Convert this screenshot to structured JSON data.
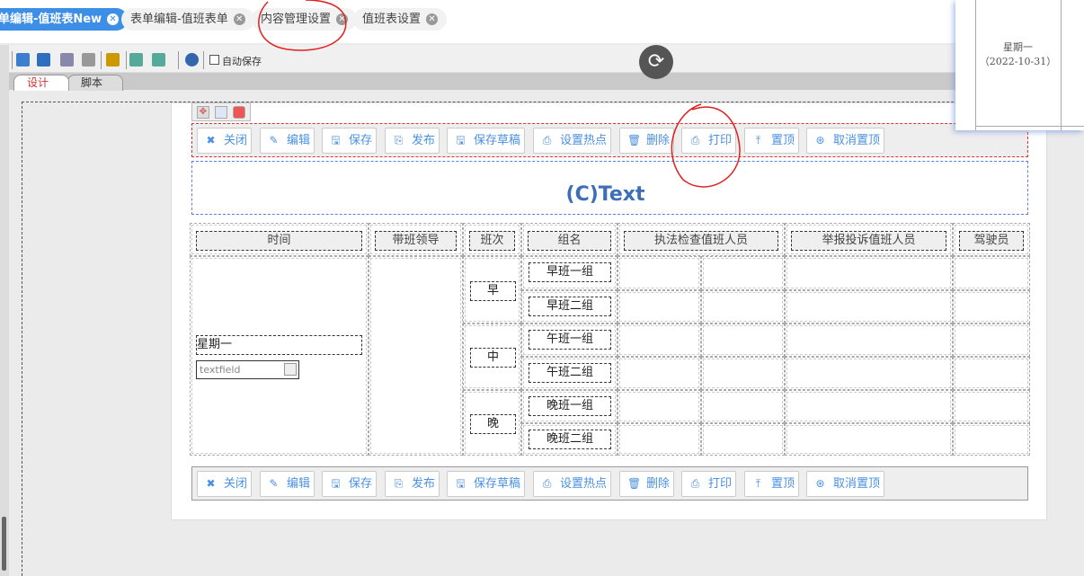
{
  "tabs": [
    {
      "label": "单编辑-值班表New",
      "active": true
    },
    {
      "label": "表单编辑-值班表单"
    },
    {
      "label": "内容管理设置"
    },
    {
      "label": "值班表设置"
    }
  ],
  "toolbar": {
    "autosave_label": "自动保存",
    "icons": [
      "save-icon",
      "save-as-icon",
      "preview-icon",
      "print-icon",
      "wand-icon",
      "import-icon",
      "export-icon",
      "help-icon"
    ]
  },
  "designer_tabs": [
    "设计",
    "脚本"
  ],
  "buttons": [
    {
      "label": "关闭",
      "icon": "✖"
    },
    {
      "label": "编辑",
      "icon": "✎"
    },
    {
      "label": "保存",
      "icon": "🖫"
    },
    {
      "label": "发布",
      "icon": "⎘"
    },
    {
      "label": "保存草稿",
      "icon": "🖫"
    },
    {
      "label": "设置热点",
      "icon": "⎙"
    },
    {
      "label": "删除",
      "icon": "🗑"
    },
    {
      "label": "打印",
      "icon": "⎙"
    },
    {
      "label": "置顶",
      "icon": "⤒"
    },
    {
      "label": "取消置顶",
      "icon": "⊛"
    }
  ],
  "text_widget": "(C)Text",
  "table": {
    "headers": [
      "时间",
      "带班领导",
      "班次",
      "组名",
      "执法检查值班人员",
      "举报投诉值班人员",
      "驾驶员"
    ],
    "day_label": "星期一",
    "textfield_value": "textfield",
    "shifts": [
      "早",
      "中",
      "晚"
    ],
    "groups": [
      "早班一组",
      "早班二组",
      "午班一组",
      "午班二组",
      "晚班一组",
      "晚班二组"
    ]
  },
  "popup": {
    "day": "星期一",
    "date": "（2022-10-31）"
  },
  "colors": {
    "accent": "#3c8ee6",
    "annotation": "#e02020"
  }
}
